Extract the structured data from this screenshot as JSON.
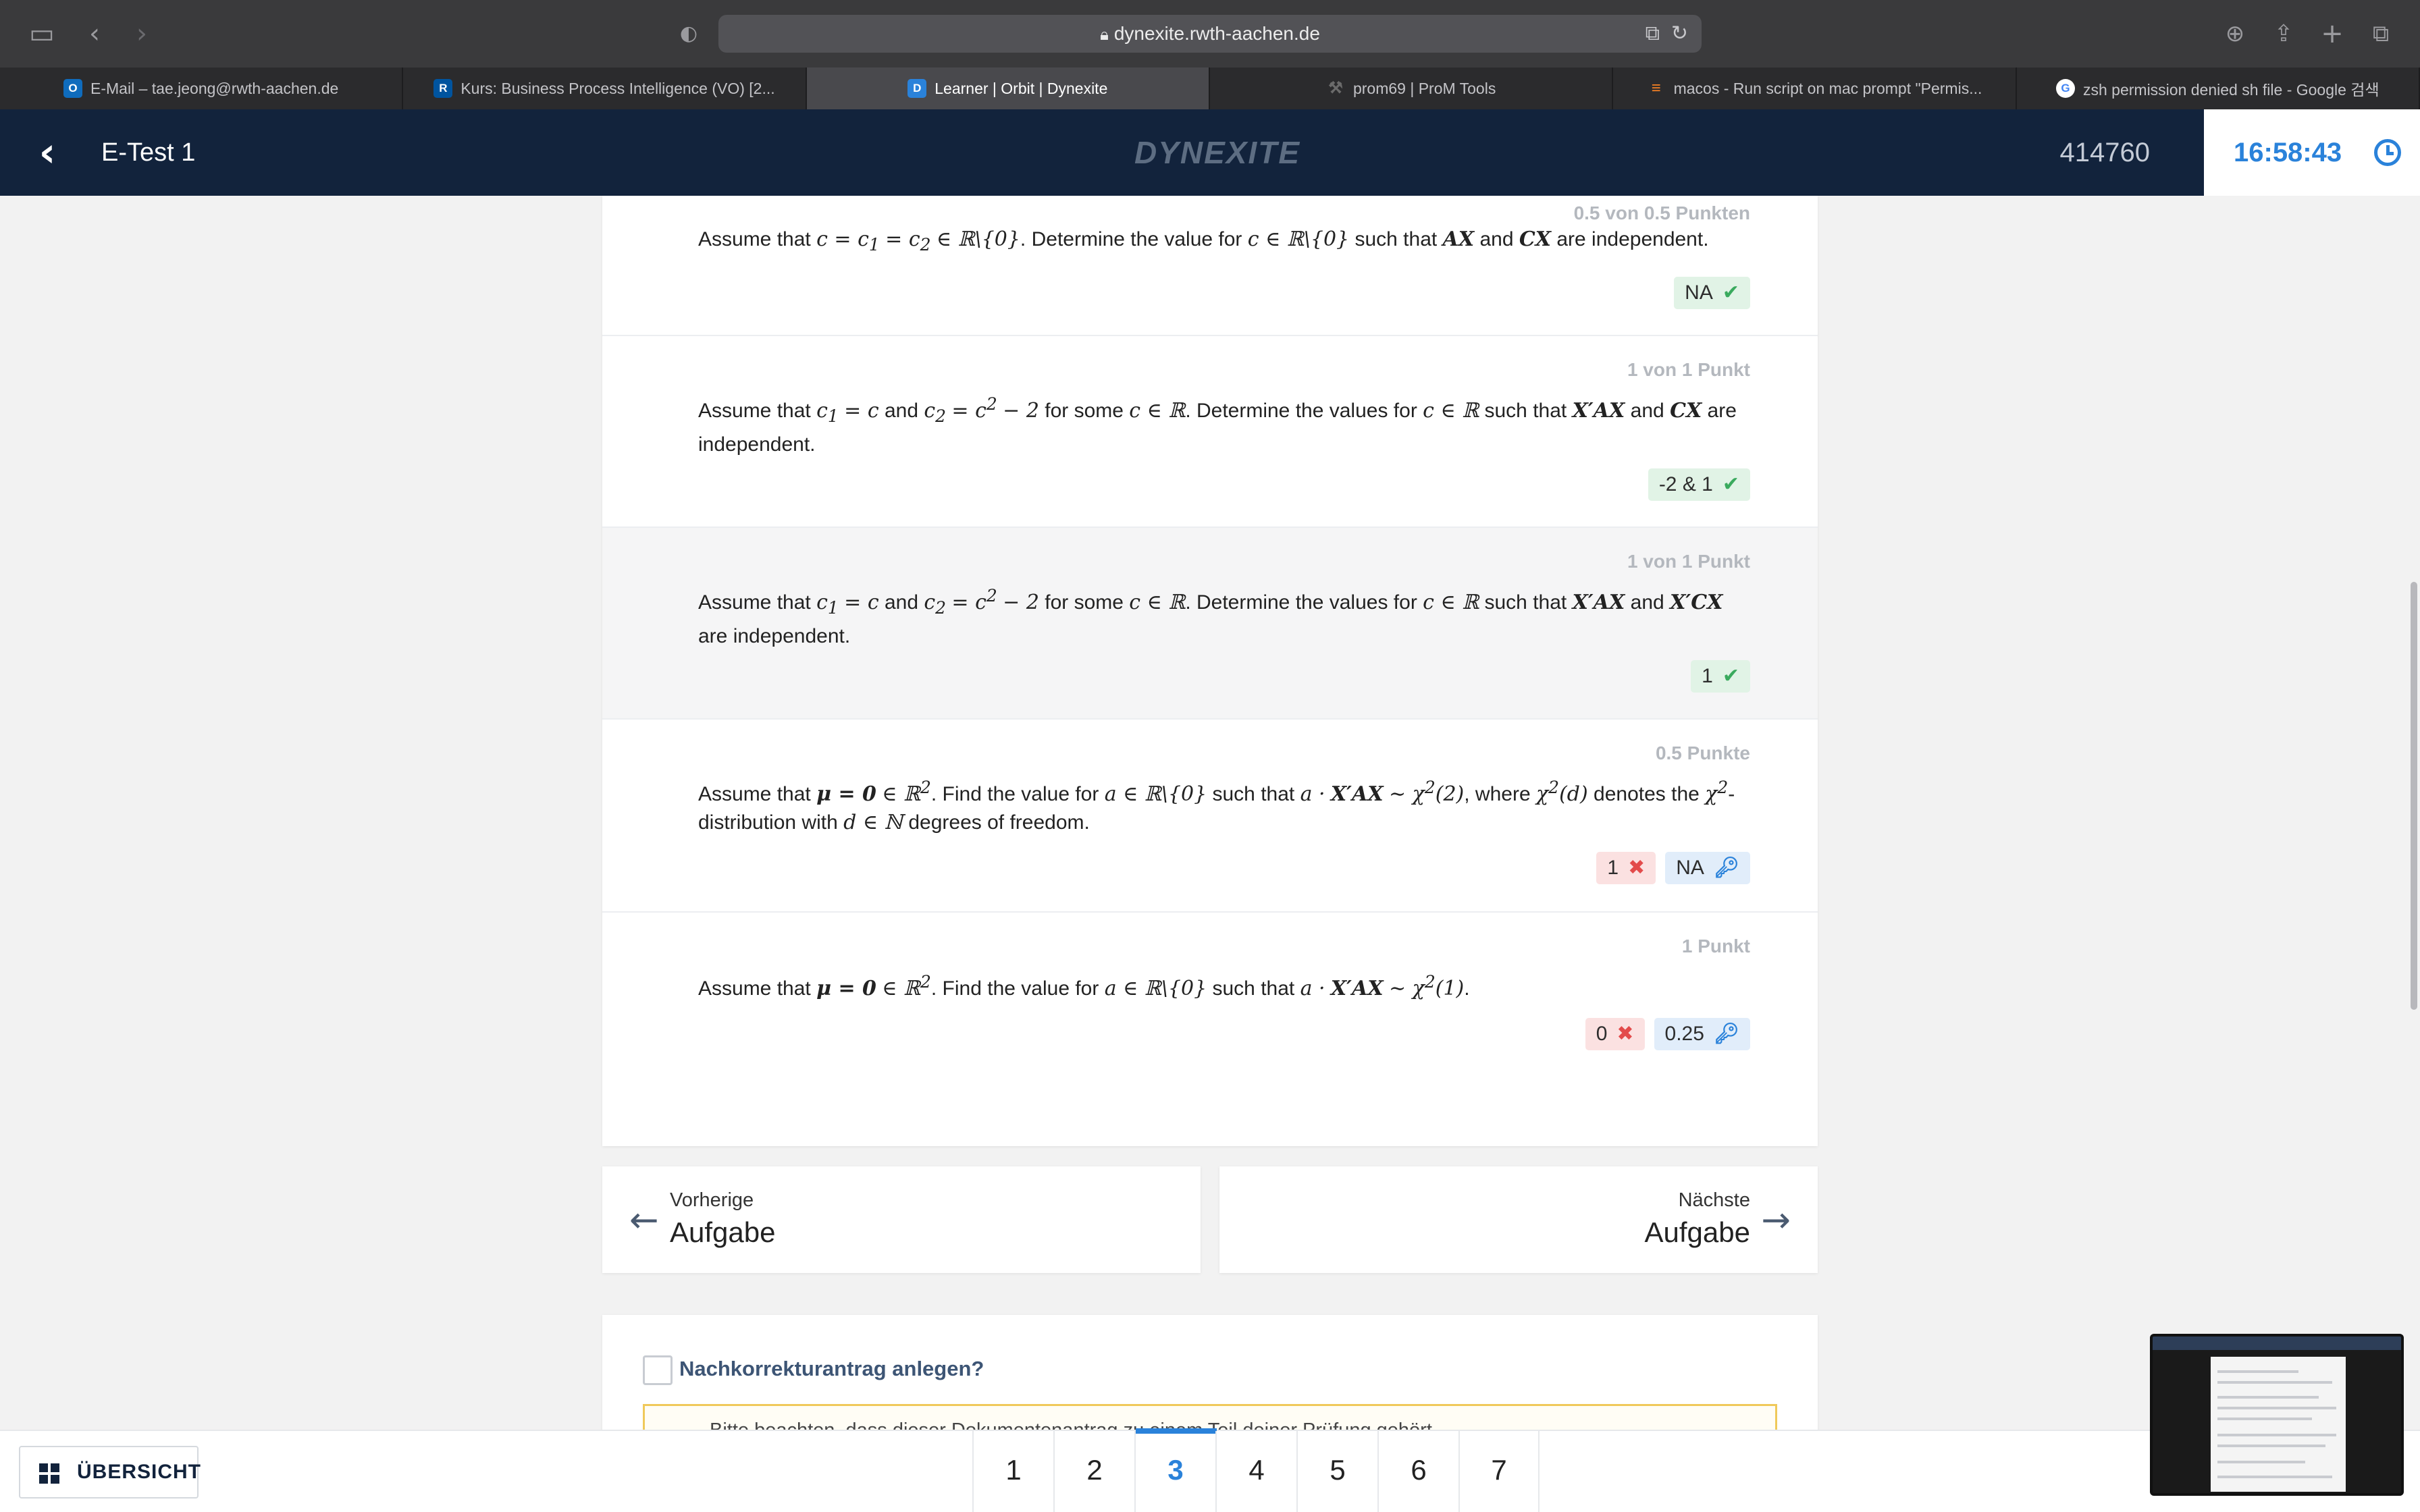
{
  "browser": {
    "url": "dynexite.rwth-aachen.de",
    "tabs": [
      {
        "label": "E-Mail – tae.jeong@rwth-aachen.de",
        "icon": "outlook-icon",
        "color": "#0f6cbd",
        "glyph": "O"
      },
      {
        "label": "Kurs: Business Process Intelligence (VO) [2...",
        "icon": "rwth-icon",
        "color": "#00549f",
        "glyph": "R"
      },
      {
        "label": "Learner | Orbit | Dynexite",
        "icon": "dynexite-icon",
        "color": "#2a82da",
        "glyph": "D"
      },
      {
        "label": "prom69 | ProM Tools",
        "icon": "wrench-icon",
        "color": "#6b6b6b",
        "glyph": "⚒"
      },
      {
        "label": "macos - Run script on mac prompt \"Permis...",
        "icon": "stackoverflow-icon",
        "color": "#f48024",
        "glyph": "≡"
      },
      {
        "label": "zsh permission denied sh file - Google 검색",
        "icon": "google-icon",
        "color": "#ffffff",
        "glyph": "G"
      }
    ]
  },
  "header": {
    "title": "E-Test 1",
    "logo": "DYNEXITE",
    "user_id": "414760",
    "timer": "16:58:43"
  },
  "questions": [
    {
      "points": "0.5 von 0.5 Punkten",
      "answers": [
        {
          "value": "NA",
          "status": "correct"
        }
      ]
    },
    {
      "points": "1 von 1 Punkt",
      "answers": [
        {
          "value": "-2 & 1",
          "status": "correct"
        }
      ]
    },
    {
      "points": "1 von 1 Punkt",
      "answers": [
        {
          "value": "1",
          "status": "correct"
        }
      ]
    },
    {
      "points": "0.5 Punkte",
      "answers": [
        {
          "value": "1",
          "status": "wrong"
        },
        {
          "value": "NA",
          "status": "solution"
        }
      ]
    },
    {
      "points": "1 Punkt",
      "answers": [
        {
          "value": "0",
          "status": "wrong"
        },
        {
          "value": "0.25",
          "status": "solution"
        }
      ]
    }
  ],
  "nav": {
    "prev_small": "Vorherige",
    "prev_big": "Aufgabe",
    "next_small": "Nächste",
    "next_big": "Aufgabe"
  },
  "korrektur": {
    "label": "Nachkorrekturantrag anlegen?",
    "notice": "Bitte beachten, dass dieser Dokumentenantrag zu einem Teil deiner Prüfung gehört..."
  },
  "bottom": {
    "overview_label": "ÜBERSICHT",
    "pages": [
      "1",
      "2",
      "3",
      "4",
      "5",
      "6",
      "7"
    ],
    "active_page": "3"
  },
  "colors": {
    "header_bg": "#12233c",
    "accent": "#2a82da",
    "correct": "#3aaa5e",
    "wrong": "#e34b4b"
  }
}
